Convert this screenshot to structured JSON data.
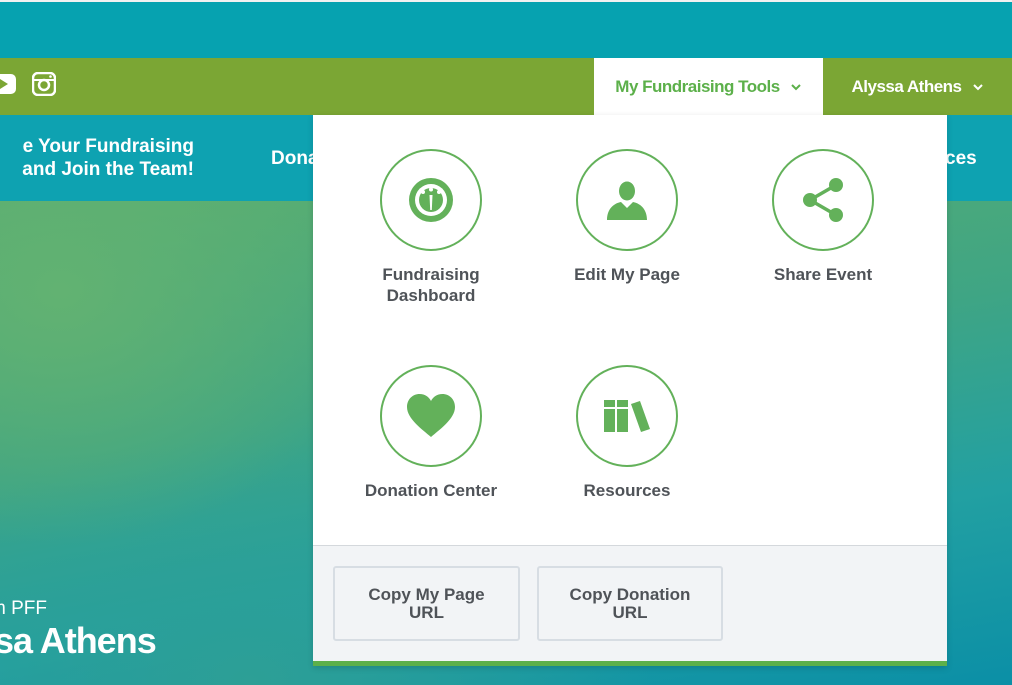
{
  "header": {
    "social_icons": [
      "youtube-icon",
      "instagram-icon"
    ],
    "tools_menu_label": "My Fundraising Tools",
    "user_menu_label": "Alyssa Athens"
  },
  "nav": {
    "promo_line1": "e Your Fundraising",
    "promo_line2": "and Join the Team!",
    "item_partial_left": "Dona",
    "item_partial_right": "ces"
  },
  "hero": {
    "subtitle": "m PFF",
    "name": "sa Athens"
  },
  "dropdown": {
    "tools": [
      {
        "label_line1": "Fundraising",
        "label_line2": "Dashboard",
        "icon": "dashboard-gauge-icon"
      },
      {
        "label_line1": "Edit My Page",
        "label_line2": "",
        "icon": "person-icon"
      },
      {
        "label_line1": "Share Event",
        "label_line2": "",
        "icon": "share-icon"
      },
      {
        "label_line1": "Donation Center",
        "label_line2": "",
        "icon": "heart-icon"
      },
      {
        "label_line1": "Resources",
        "label_line2": "",
        "icon": "books-icon"
      }
    ],
    "copy_page_line1": "Copy My Page",
    "copy_page_line2": "URL",
    "copy_donation_line1": "Copy Donation",
    "copy_donation_line2": "URL"
  },
  "colors": {
    "accent_green": "#5cb04a",
    "bar_green": "#7ba634",
    "teal": "#06a2b0",
    "text_gray": "#4f5358"
  }
}
